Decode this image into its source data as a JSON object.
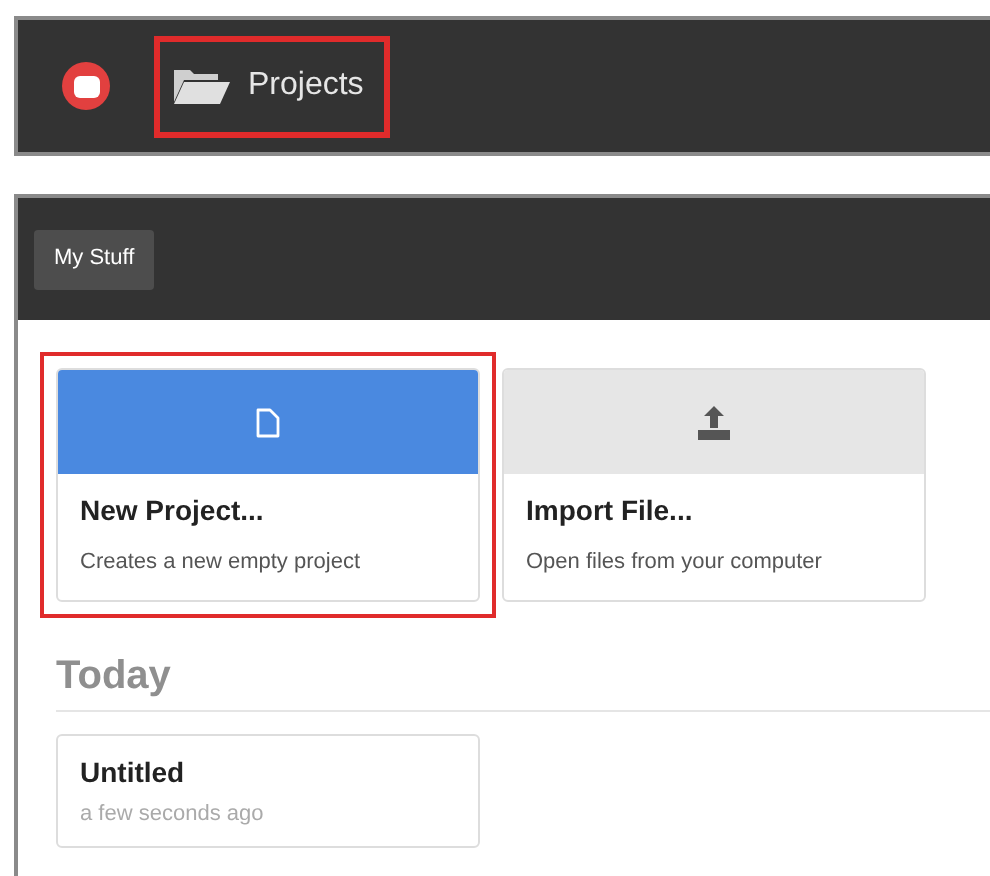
{
  "top_bar": {
    "nav_item": {
      "label": "Projects",
      "highlighted": true
    }
  },
  "tabs": [
    {
      "label": "My Stuff",
      "selected": true
    }
  ],
  "actions": [
    {
      "kind": "new",
      "title": "New Project...",
      "description": "Creates a new empty project",
      "color": "#4a89e0",
      "highlighted": true
    },
    {
      "kind": "import",
      "title": "Import File...",
      "description": "Open files from your computer",
      "color": "#e6e6e6",
      "highlighted": false
    }
  ],
  "sections": [
    {
      "heading": "Today",
      "projects": [
        {
          "title": "Untitled",
          "time": "a few seconds ago"
        }
      ]
    }
  ]
}
